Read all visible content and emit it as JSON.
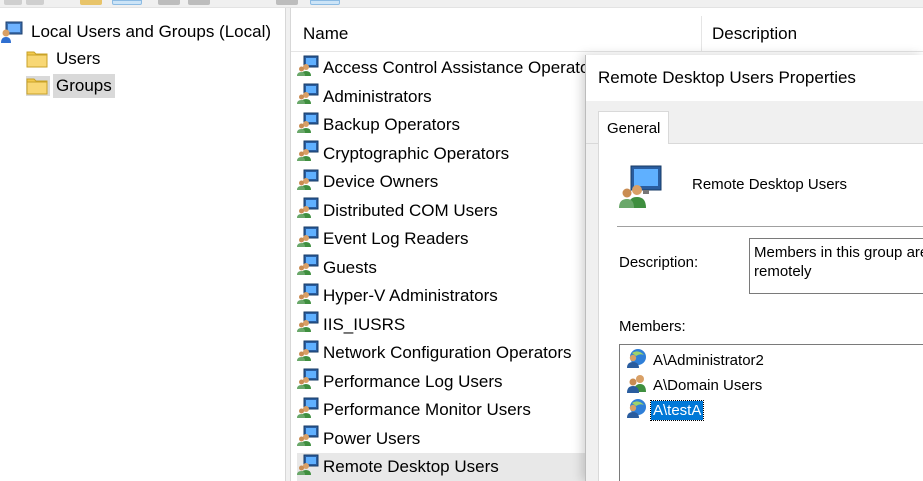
{
  "tree": {
    "root_label": "Local Users and Groups (Local)",
    "items": [
      {
        "label": "Users",
        "selected": false
      },
      {
        "label": "Groups",
        "selected": true
      }
    ]
  },
  "list": {
    "columns": {
      "name": "Name",
      "description": "Description"
    },
    "rows": [
      {
        "name": "Access Control Assistance Operators",
        "selected": false
      },
      {
        "name": "Administrators",
        "selected": false
      },
      {
        "name": "Backup Operators",
        "selected": false
      },
      {
        "name": "Cryptographic Operators",
        "selected": false
      },
      {
        "name": "Device Owners",
        "selected": false
      },
      {
        "name": "Distributed COM Users",
        "selected": false
      },
      {
        "name": "Event Log Readers",
        "selected": false
      },
      {
        "name": "Guests",
        "selected": false
      },
      {
        "name": "Hyper-V Administrators",
        "selected": false
      },
      {
        "name": "IIS_IUSRS",
        "selected": false
      },
      {
        "name": "Network Configuration Operators",
        "selected": false
      },
      {
        "name": "Performance Log Users",
        "selected": false
      },
      {
        "name": "Performance Monitor Users",
        "selected": false
      },
      {
        "name": "Power Users",
        "selected": false
      },
      {
        "name": "Remote Desktop Users",
        "selected": true
      }
    ]
  },
  "dialog": {
    "title": "Remote Desktop Users Properties",
    "tabs": [
      {
        "label": "General",
        "active": true
      }
    ],
    "group_name": "Remote Desktop Users",
    "description_label": "Description:",
    "description_value_line1": "Members in this group are",
    "description_value_line2": "remotely",
    "members_label": "Members:",
    "members": [
      {
        "name": "A\\Administrator2",
        "icon": "user-icon",
        "selected": false
      },
      {
        "name": "A\\Domain Users",
        "icon": "group-icon",
        "selected": false
      },
      {
        "name": "A\\testA",
        "icon": "user-icon",
        "selected": true
      }
    ]
  },
  "colors": {
    "selection_blue": "#0078d7",
    "tree_selection": "#d9d9d9",
    "dialog_background": "#f0f0f0"
  }
}
